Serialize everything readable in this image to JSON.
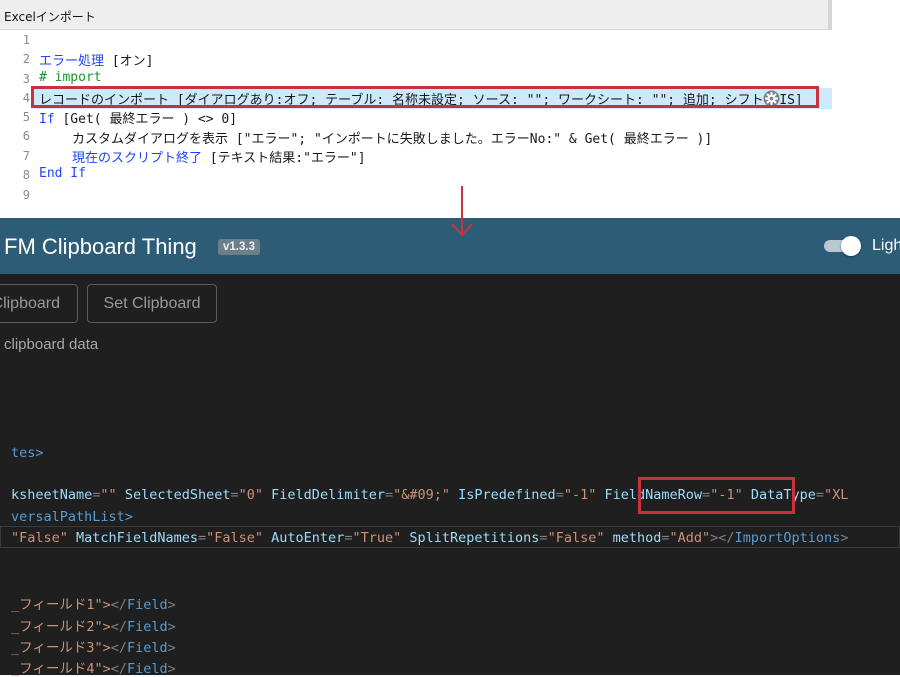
{
  "script_editor": {
    "window_title": "Excelインポート",
    "line_numbers": [
      "1",
      "2",
      "3",
      "4",
      "5",
      "6",
      "7",
      "8",
      "9"
    ],
    "lines": {
      "l2_keyword": "エラー処理",
      "l2_rest": " [オン]",
      "l3": "# import",
      "l4": "レコードのインポート [ダイアログあり:オフ; テーブル: 名称未設定; ソース: \"\"; ワークシート: \"\"; 追加; シフト JIS]",
      "l5_keyword": "If",
      "l5_rest": " [Get( 最終エラー ) <> 0]",
      "l6": "カスタムダイアログを表示 [\"エラー\"; \"インポートに失敗しました。エラーNo:\" & Get( 最終エラー )]",
      "l7_keyword": "現在のスクリプト終了",
      "l7_rest": " [テキスト結果:\"エラー\"]",
      "l8_keyword": "End If"
    },
    "gear_icon": "gear-icon",
    "highlight_color": "#c8323c",
    "arrow_color": "#c8323c"
  },
  "app": {
    "title": "FM Clipboard Thing",
    "version": "v1.3.3",
    "theme_label": "Light",
    "header_color": "#2d5c77",
    "get_clipboard_button": "Clipboard",
    "set_clipboard_button": "Set Clipboard",
    "status": "clipboard data"
  },
  "xml_view": {
    "line1": "tes>",
    "line2": {
      "a1": "ksheetName",
      "v1": "\"\"",
      "a2": "SelectedSheet",
      "v2": "\"0\"",
      "a3": "FieldDelimiter",
      "v3": "\"&#09;\"",
      "a4": "IsPredefined",
      "v4": "\"-1\"",
      "a5": "FieldNameRow",
      "v5": "\"-1\"",
      "a6": "DataType",
      "v6": "\"XL"
    },
    "line3": "versalPathList>",
    "line4": {
      "v0": "\"False\"",
      "a1": "MatchFieldNames",
      "v1": "\"False\"",
      "a2": "AutoEnter",
      "v2": "\"True\"",
      "a3": "SplitRepetitions",
      "v3": "\"False\"",
      "a4": "method",
      "v4": "\"Add\"",
      "close_tag": "ImportOptions"
    },
    "field_lines": [
      {
        "text": "_フィールド1\">",
        "close": "Field"
      },
      {
        "text": "_フィールド2\">",
        "close": "Field"
      },
      {
        "text": "_フィールド3\">",
        "close": "Field"
      },
      {
        "text": "_フィールド4\">",
        "close": "Field"
      }
    ]
  }
}
